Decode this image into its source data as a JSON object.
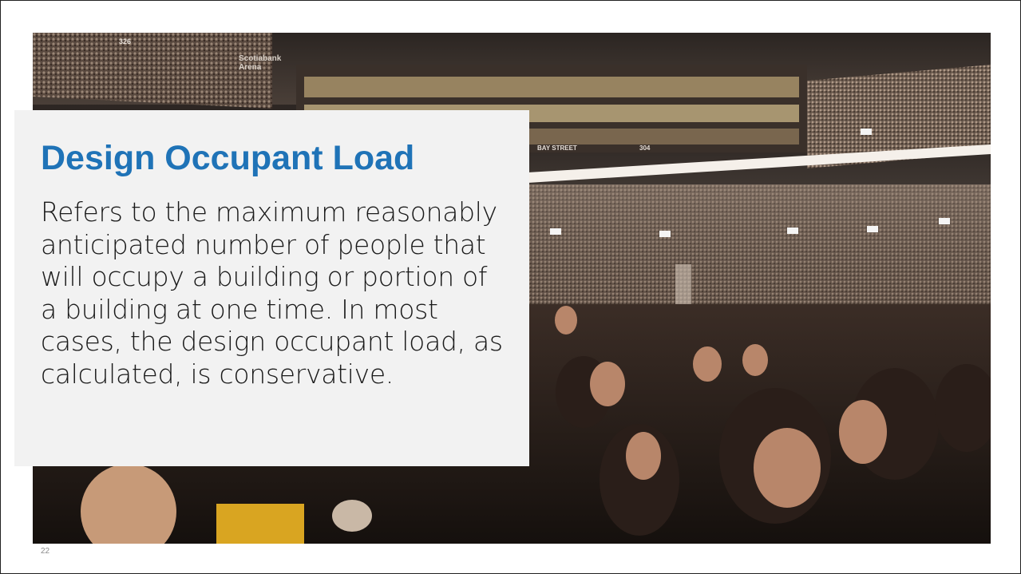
{
  "slide": {
    "title": "Design Occupant Load",
    "body": "Refers to the maximum reasonably anticipated number of people that will occupy a building or portion of a building at one time. In most cases, the design occupant load, as calculated, is conservative.",
    "page_number": "22"
  },
  "photo": {
    "signage": [
      "Scotiabank Arena",
      "BAY STREET",
      "304",
      "326"
    ]
  },
  "colors": {
    "title": "#1f73b7",
    "text_panel": "#f2f2f2",
    "body_text": "#1a1a1a"
  }
}
